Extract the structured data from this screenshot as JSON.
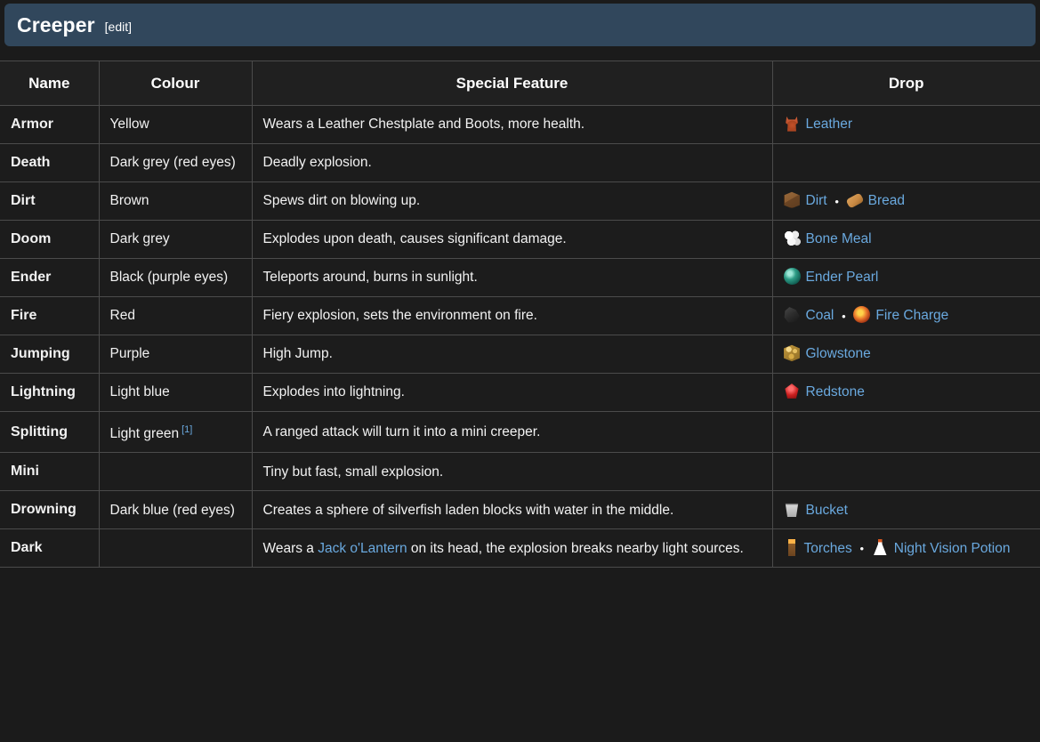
{
  "heading": {
    "title": "Creeper",
    "edit_label": "[edit]"
  },
  "table": {
    "columns": [
      "Name",
      "Colour",
      "Special Feature",
      "Drop"
    ],
    "rows": [
      {
        "name": "Armor",
        "colour": "Yellow",
        "colour_ref": "",
        "feature": "Wears a Leather Chestplate and Boots, more health.",
        "drops": [
          {
            "icon": "leather-icon",
            "label": "Leather"
          }
        ]
      },
      {
        "name": "Death",
        "colour": "Dark grey (red eyes)",
        "colour_ref": "",
        "feature": "Deadly explosion.",
        "drops": []
      },
      {
        "name": "Dirt",
        "colour": "Brown",
        "colour_ref": "",
        "feature": "Spews dirt on blowing up.",
        "drops": [
          {
            "icon": "dirt-icon",
            "label": "Dirt"
          },
          {
            "icon": "bread-icon",
            "label": "Bread"
          }
        ]
      },
      {
        "name": "Doom",
        "colour": "Dark grey",
        "colour_ref": "",
        "feature": "Explodes upon death, causes significant damage.",
        "drops": [
          {
            "icon": "bone-meal-icon",
            "label": "Bone Meal"
          }
        ]
      },
      {
        "name": "Ender",
        "colour": "Black (purple eyes)",
        "colour_ref": "",
        "feature": "Teleports around, burns in sunlight.",
        "drops": [
          {
            "icon": "ender-pearl-icon",
            "label": "Ender Pearl"
          }
        ]
      },
      {
        "name": "Fire",
        "colour": "Red",
        "colour_ref": "",
        "feature": "Fiery explosion, sets the environment on fire.",
        "drops": [
          {
            "icon": "coal-icon",
            "label": "Coal"
          },
          {
            "icon": "fire-charge-icon",
            "label": "Fire Charge"
          }
        ]
      },
      {
        "name": "Jumping",
        "colour": "Purple",
        "colour_ref": "",
        "feature": "High Jump.",
        "drops": [
          {
            "icon": "glowstone-icon",
            "label": "Glowstone"
          }
        ]
      },
      {
        "name": "Lightning",
        "colour": "Light blue",
        "colour_ref": "",
        "feature": "Explodes into lightning.",
        "drops": [
          {
            "icon": "redstone-icon",
            "label": "Redstone"
          }
        ]
      },
      {
        "name": "Splitting",
        "colour": "Light green",
        "colour_ref": "[1]",
        "feature": "A ranged attack will turn it into a mini creeper.",
        "drops": []
      },
      {
        "name": "Mini",
        "colour": "",
        "colour_ref": "",
        "feature": "Tiny but fast, small explosion.",
        "drops": []
      },
      {
        "name": "Drowning",
        "colour": "Dark blue (red eyes)",
        "colour_ref": "",
        "feature": "Creates a sphere of silverfish laden blocks with water in the middle.",
        "drops": [
          {
            "icon": "bucket-icon",
            "label": "Bucket"
          }
        ]
      },
      {
        "name": "Dark",
        "colour": "",
        "colour_ref": "",
        "feature_parts": [
          {
            "text": "Wears a ",
            "link": false
          },
          {
            "text": "Jack o'Lantern",
            "link": true
          },
          {
            "text": " on its head, the explosion breaks nearby light sources.",
            "link": false
          }
        ],
        "feature": "",
        "drops": [
          {
            "icon": "torch-icon",
            "label": "Torches"
          },
          {
            "icon": "night-vision-potion-icon",
            "label": "Night Vision Potion"
          }
        ]
      }
    ]
  },
  "separator": "•",
  "colors": {
    "heading_bg": "#31475c",
    "link": "#6aa9df",
    "table_bg": "#1c1c1c",
    "border": "#4b4b4b",
    "page_bg": "#1b1b1b"
  }
}
